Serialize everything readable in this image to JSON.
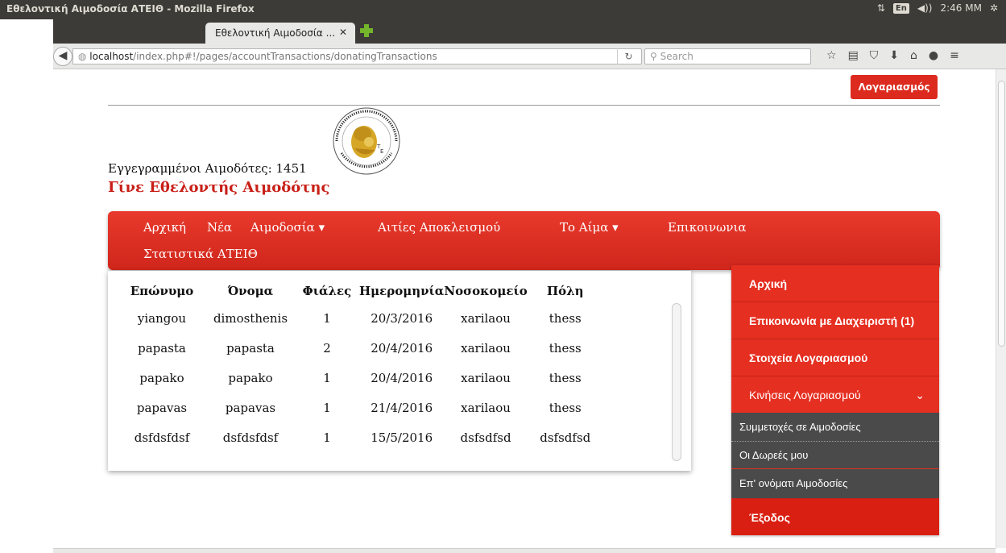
{
  "window": {
    "title": "Εθελοντική Αιμοδοσία ΑΤΕΙΘ - Mozilla Firefox"
  },
  "tray": {
    "keyboard": "En",
    "time": "2:46 ΜΜ"
  },
  "browser": {
    "tab_title": "Εθελοντική Αιμοδοσία ...",
    "url_host": "localhost",
    "url_path": "/index.php#!/pages/accountTransactions/donatingTransactions",
    "search_placeholder": "Search"
  },
  "page": {
    "account_button": "Λογαριασμός",
    "donors_label": "Εγγεγραμμένοι Αιμοδότες:",
    "donors_count": "1451",
    "volunteer_link": "Γίνε Εθελοντής Αιμοδότης"
  },
  "nav": {
    "home": "Αρχική",
    "news": "Νέα",
    "donation": "Αιμοδοσία ▾",
    "exclusions": "Αιτίες Αποκλεισμού",
    "blood": "Το Αίμα ▾",
    "contact": "Επικοινωνια",
    "stats": "Στατιστικά ΑΤΕΙΘ"
  },
  "table": {
    "headers": [
      "Επώνυμο",
      "Όνομα",
      "Φιάλες",
      "Ημερομηνία",
      "Νοσοκομείο",
      "Πόλη"
    ],
    "rows": [
      [
        "yiangou",
        "dimosthenis",
        "1",
        "20/3/2016",
        "xarilaou",
        "thess"
      ],
      [
        "papasta",
        "papasta",
        "2",
        "20/4/2016",
        "xarilaou",
        "thess"
      ],
      [
        "papako",
        "papako",
        "1",
        "20/4/2016",
        "xarilaou",
        "thess"
      ],
      [
        "papavas",
        "papavas",
        "1",
        "21/4/2016",
        "xarilaou",
        "thess"
      ],
      [
        "dsfdsfdsf",
        "dsfdsfdsf",
        "1",
        "15/5/2016",
        "dsfsdfsd",
        "dsfsdfsd"
      ]
    ]
  },
  "sidemenu": {
    "home": "Αρχική",
    "contact_admin": "Επικοινωνία με Διαχειριστή (1)",
    "account_details": "Στοιχεία Λογαριασμού",
    "account_transactions": "Κινήσεις Λογαριασμού",
    "sub_participations": "Συμμετοχές σε Αιμοδοσίες",
    "sub_donations": "Οι Δωρεές μου",
    "sub_on_behalf": "Επ' ονόματι Αιμοδοσίες",
    "logout": "Έξοδος"
  }
}
